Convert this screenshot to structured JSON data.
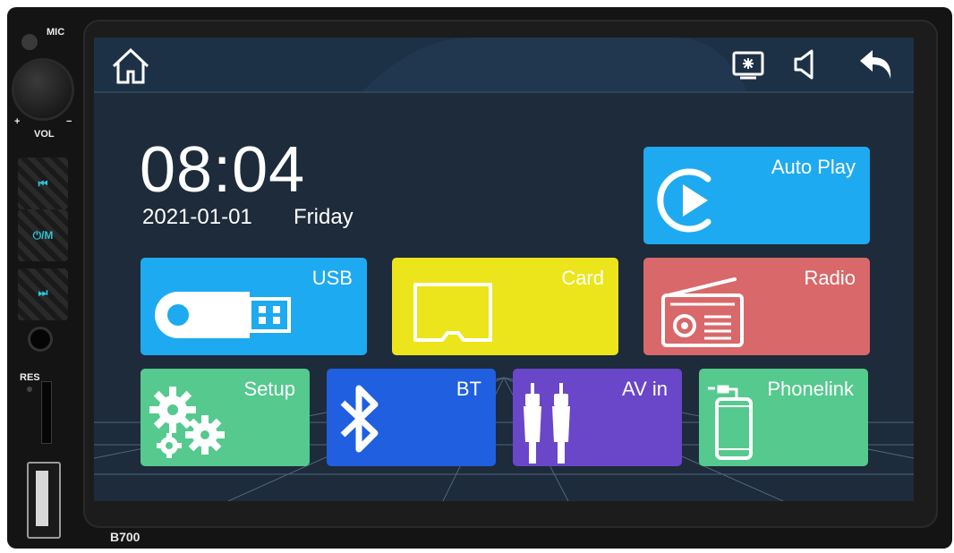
{
  "device": {
    "mic_label": "MIC",
    "vol_label": "VOL",
    "vol_plus": "+",
    "vol_minus": "−",
    "prev_label": "⏮",
    "power_mode_label": "⏻/M",
    "next_label": "⏭",
    "res_label": "RES",
    "model": "B700"
  },
  "topbar": {
    "icons": [
      "home-icon",
      "brightness-icon",
      "volume-icon",
      "back-icon"
    ]
  },
  "clock": {
    "time": "08:04",
    "date": "2021-01-01",
    "weekday": "Friday"
  },
  "tiles": {
    "autoplay": {
      "label": "Auto Play",
      "color": "#1eaaf0",
      "icon": "play-circle-icon"
    },
    "usb": {
      "label": "USB",
      "color": "#1eaaf0",
      "icon": "usb-drive-icon"
    },
    "card": {
      "label": "Card",
      "color": "#ece51b",
      "icon": "sd-card-icon"
    },
    "radio": {
      "label": "Radio",
      "color": "#d9686a",
      "icon": "radio-icon"
    },
    "setup": {
      "label": "Setup",
      "color": "#55c98e",
      "icon": "gears-icon"
    },
    "bt": {
      "label": "BT",
      "color": "#1f5fe0",
      "icon": "bluetooth-icon"
    },
    "avin": {
      "label": "AV in",
      "color": "#6a46c9",
      "icon": "rca-cable-icon"
    },
    "phonelink": {
      "label": "Phonelink",
      "color": "#55c98e",
      "icon": "phone-icon"
    }
  }
}
